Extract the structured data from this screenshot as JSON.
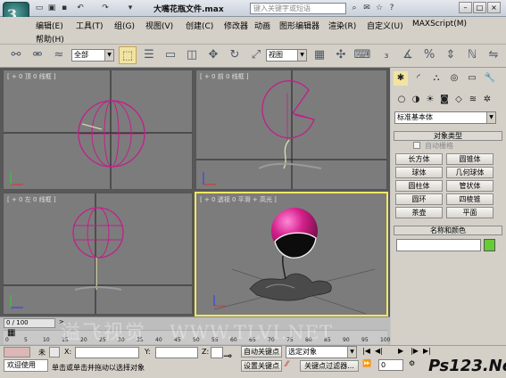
{
  "window": {
    "title": "大嘴花瓶文件.max",
    "search_placeholder": "键入关键字或短语"
  },
  "menu": {
    "row1": [
      "编辑(E)",
      "工具(T)",
      "组(G)",
      "视图(V)",
      "创建(C)",
      "修改器",
      "动画",
      "图形编辑器",
      "渲染(R)",
      "自定义(U)",
      "MAXScript(M)"
    ],
    "row2": [
      "帮助(H)"
    ]
  },
  "toolbar": {
    "filter_select": "全部",
    "view_select": "视图"
  },
  "viewports": {
    "top": "[ + 0 顶 0 线框 ]",
    "front": "[ + 0 前 0 线框 ]",
    "left": "[ + 0 左 0 线框 ]",
    "perspective": "[ + 0 透视 0 平滑 + 高光 ]"
  },
  "command_panel": {
    "category": "标准基本体",
    "object_type_header": "对象类型",
    "autogrid_label": "自动栅格",
    "buttons": [
      "长方体",
      "圆锥体",
      "球体",
      "几何球体",
      "圆柱体",
      "管状体",
      "圆环",
      "四棱锥",
      "茶壶",
      "平面"
    ],
    "name_color_header": "名称和颜色",
    "object_color": "#66cc33"
  },
  "timeline": {
    "frame": "0 / 100",
    "ticks": [
      "0",
      "5",
      "10",
      "15",
      "20",
      "25",
      "30",
      "35",
      "40",
      "45",
      "50",
      "55",
      "60",
      "65",
      "70",
      "75",
      "80",
      "85",
      "90",
      "95",
      "100"
    ]
  },
  "status": {
    "welcome": "欢迎使用",
    "no_select": "未",
    "x_label": "X:",
    "y_label": "Y:",
    "z_label": "Z:",
    "prompt": "单击或单击并拖动以选择对象",
    "auto_key": "自动关键点",
    "set_key": "设置关键点",
    "key_filter_select": "选定对象",
    "key_filters": "关键点过滤器...",
    "frame_value": "0"
  },
  "watermark": {
    "left": "溢飞视觉",
    "site": "WWW.TLVI.NET",
    "brand": "Ps123.Net"
  },
  "colors": {
    "selected_object": "#d4208a",
    "active_border": "#f5e85f",
    "wireframe": "#c0208a"
  }
}
